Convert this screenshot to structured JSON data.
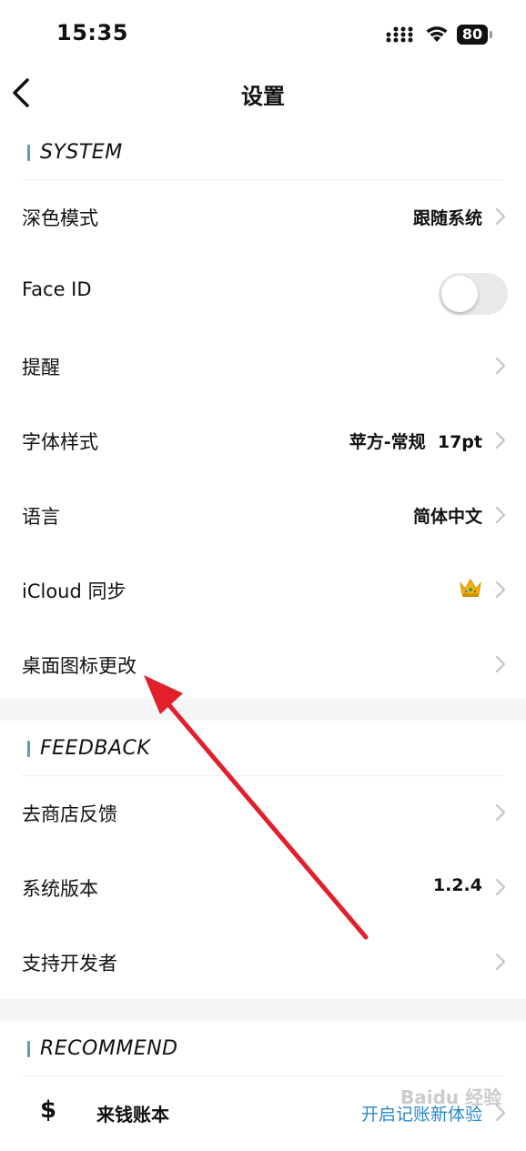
{
  "status_bar": {
    "time": "15:35",
    "battery": "80"
  },
  "nav": {
    "title": "设置"
  },
  "sections": {
    "system": {
      "title": "SYSTEM",
      "dark_mode": {
        "label": "深色模式",
        "value": "跟随系统"
      },
      "face_id": {
        "label": "Face ID",
        "enabled": false
      },
      "reminder": {
        "label": "提醒"
      },
      "font_style": {
        "label": "字体样式",
        "value": "苹方-常规  17pt"
      },
      "language": {
        "label": "语言",
        "value": "简体中文"
      },
      "icloud": {
        "label": "iCloud 同步",
        "badge_icon": "crown-icon"
      },
      "app_icon": {
        "label": "桌面图标更改"
      }
    },
    "feedback": {
      "title": "FEEDBACK",
      "store_feedback": {
        "label": "去商店反馈"
      },
      "version": {
        "label": "系统版本",
        "value": "1.2.4"
      },
      "support": {
        "label": "支持开发者"
      }
    },
    "recommend": {
      "title": "RECOMMEND",
      "app": {
        "icon_text": "$",
        "label": "来钱账本",
        "link": "开启记账新体验"
      }
    }
  },
  "colors": {
    "accent_bar": "#5aa3a6",
    "link": "#2a8ac9",
    "annotation_arrow": "#e0202a"
  },
  "watermark": "Baidu 经验"
}
